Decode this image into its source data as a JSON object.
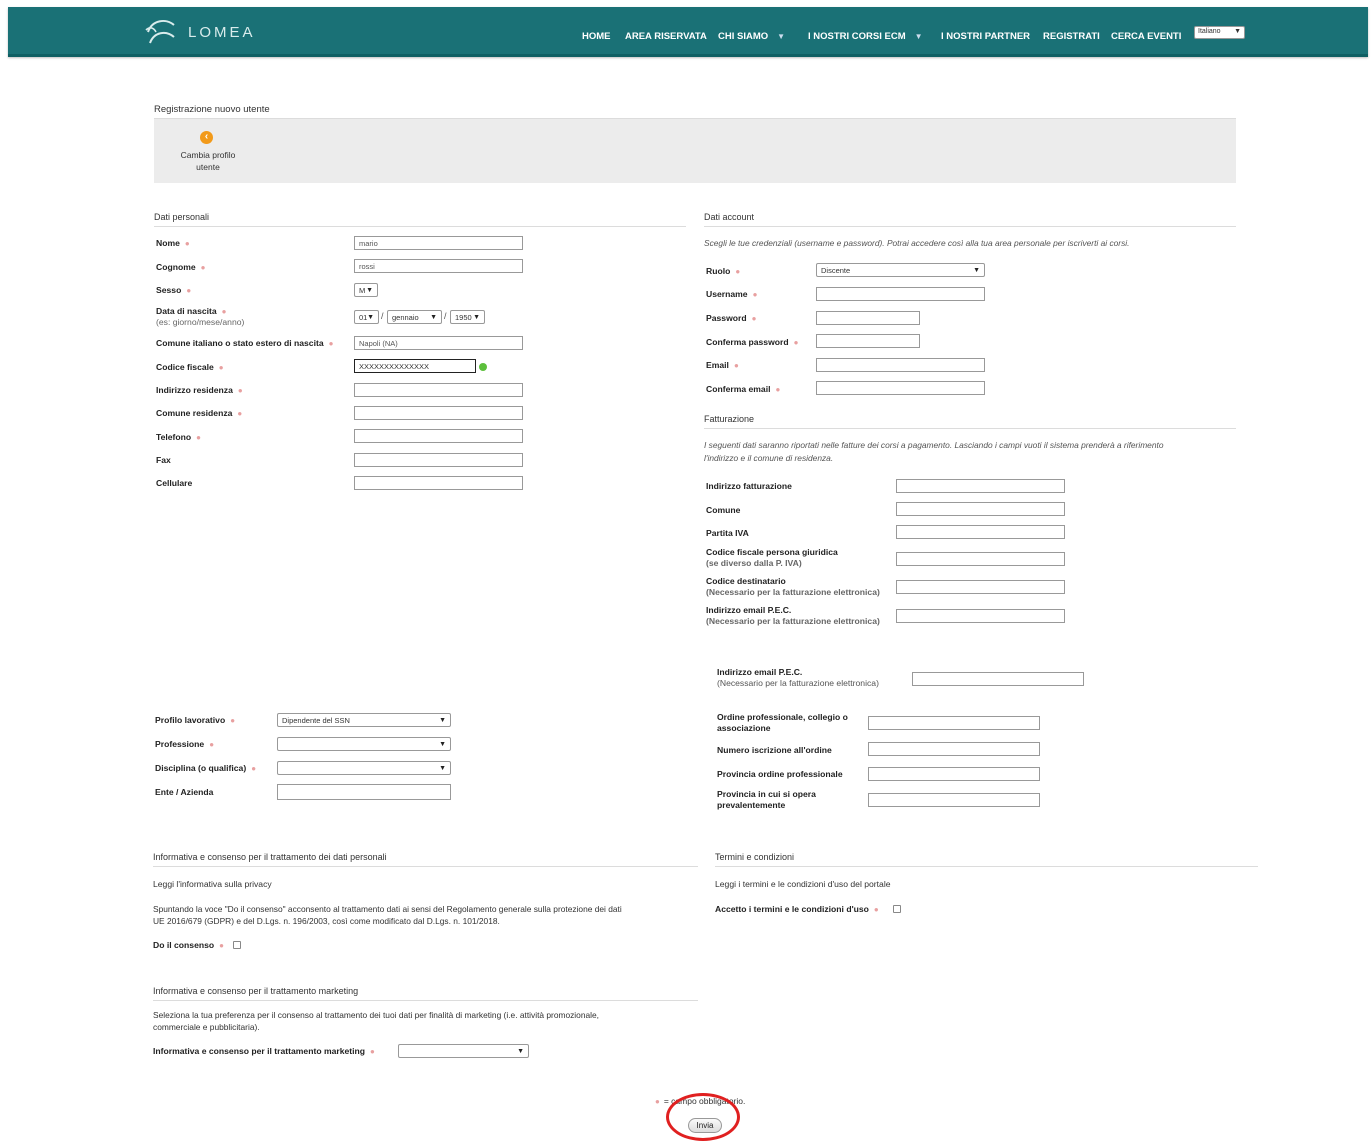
{
  "header": {
    "logo_text": "LOMEA",
    "nav": [
      {
        "label": "HOME"
      },
      {
        "label": "AREA RISERVATA"
      },
      {
        "label": "CHI SIAMO"
      },
      {
        "label": "I NOSTRI CORSI ECM"
      },
      {
        "label": "I NOSTRI PARTNER"
      },
      {
        "label": "REGISTRATI"
      },
      {
        "label": "CERCA EVENTI"
      }
    ],
    "language": "Italiano",
    "caret": "▼"
  },
  "page_title": "Registrazione nuovo utente",
  "toolbar": {
    "change_profile_label": "Cambia profilo utente",
    "icon": "arrow-left-circle-icon"
  },
  "personal": {
    "title": "Dati personali",
    "nome": {
      "label": "Nome",
      "value": "mario"
    },
    "cognome": {
      "label": "Cognome",
      "value": "rossi"
    },
    "sesso": {
      "label": "Sesso",
      "value": "M"
    },
    "nascita": {
      "label": "Data di nascita",
      "hint": "(es: giorno/mese/anno)",
      "day": "01",
      "month": "gennaio",
      "year": "1950"
    },
    "comune_nascita": {
      "label": "Comune italiano o stato estero di nascita",
      "value": "Napoli (NA)"
    },
    "codice_fiscale": {
      "label": "Codice fiscale",
      "value": "XXXXXXXXXXXXXX"
    },
    "indirizzo": {
      "label": "Indirizzo residenza",
      "value": ""
    },
    "comune_res": {
      "label": "Comune residenza",
      "value": ""
    },
    "telefono": {
      "label": "Telefono",
      "value": ""
    },
    "fax": {
      "label": "Fax",
      "value": ""
    },
    "cellulare": {
      "label": "Cellulare",
      "value": ""
    }
  },
  "account": {
    "title": "Dati account",
    "note": "Scegli le tue credenziali (username e password). Potrai accedere così alla tua area personale per iscriverti ai corsi.",
    "ruolo": {
      "label": "Ruolo",
      "value": "Discente"
    },
    "username": {
      "label": "Username"
    },
    "password": {
      "label": "Password"
    },
    "conferma_password": {
      "label": "Conferma password"
    },
    "email": {
      "label": "Email"
    },
    "conferma_email": {
      "label": "Conferma email"
    }
  },
  "billing": {
    "title": "Fatturazione",
    "note_line1": "I seguenti dati saranno riportati nelle fatture dei corsi a pagamento. Lasciando i campi vuoti il sistema prenderà a riferimento",
    "note_line2": "l'indirizzo e il comune di residenza.",
    "indirizzo": "Indirizzo fatturazione",
    "comune": "Comune",
    "piva": "Partita IVA",
    "cf_giuridica": "Codice fiscale persona giuridica",
    "cf_giuridica_hint": "(se diverso dalla P. IVA)",
    "codice_dest": "Codice destinatario",
    "codice_dest_hint": "(Necessario per la fatturazione elettronica)",
    "pec": "Indirizzo email P.E.C.",
    "pec_hint": "(Necessario per la fatturazione elettronica)"
  },
  "professional": {
    "pec": "Indirizzo email P.E.C.",
    "pec_hint": "(Necessario per la fatturazione elettronica)",
    "ordine_line1": "Ordine professionale, collegio o",
    "ordine_line2": "associazione",
    "numero_iscrizione": "Numero iscrizione all'ordine",
    "provincia_ordine": "Provincia ordine professionale",
    "provincia_opera_line1": "Provincia in cui si opera",
    "provincia_opera_line2": "prevalentemente"
  },
  "work": {
    "profilo": {
      "label": "Profilo lavorativo",
      "value": "Dipendente del SSN"
    },
    "professione": {
      "label": "Professione",
      "value": ""
    },
    "disciplina": {
      "label": "Disciplina (o qualifica)",
      "value": ""
    },
    "ente": {
      "label": "Ente / Azienda",
      "value": ""
    }
  },
  "privacy": {
    "title": "Informativa e consenso per il trattamento dei dati personali",
    "link": "Leggi l'informativa sulla privacy",
    "text_line1": "Spuntando la voce \"Do il consenso\" acconsento al trattamento dati ai sensi del Regolamento generale sulla protezione dei dati",
    "text_line2": "UE 2016/679 (GDPR) e del D.Lgs. n. 196/2003, così come modificato dal D.Lgs. n. 101/2018.",
    "consent_label": "Do il consenso"
  },
  "terms": {
    "title": "Termini e condizioni",
    "link": "Leggi i termini e le condizioni d'uso del portale",
    "accept_label": "Accetto i termini e le condizioni d'uso"
  },
  "marketing": {
    "title": "Informativa e consenso per il trattamento marketing",
    "text_line1": "Seleziona la tua preferenza per il consenso al trattamento dei tuoi dati per finalità di marketing (i.e. attività promozionale,",
    "text_line2": "commerciale e pubblicitaria).",
    "label": "Informativa e consenso per il trattamento marketing",
    "value": ""
  },
  "footer": {
    "required_note": "= campo obbligatorio.",
    "submit": "Invia"
  },
  "colors": {
    "header_bg": "#1a7176",
    "required_dot": "#e8a0a0",
    "annotation": "#e02020",
    "valid": "#5cbf3c"
  }
}
